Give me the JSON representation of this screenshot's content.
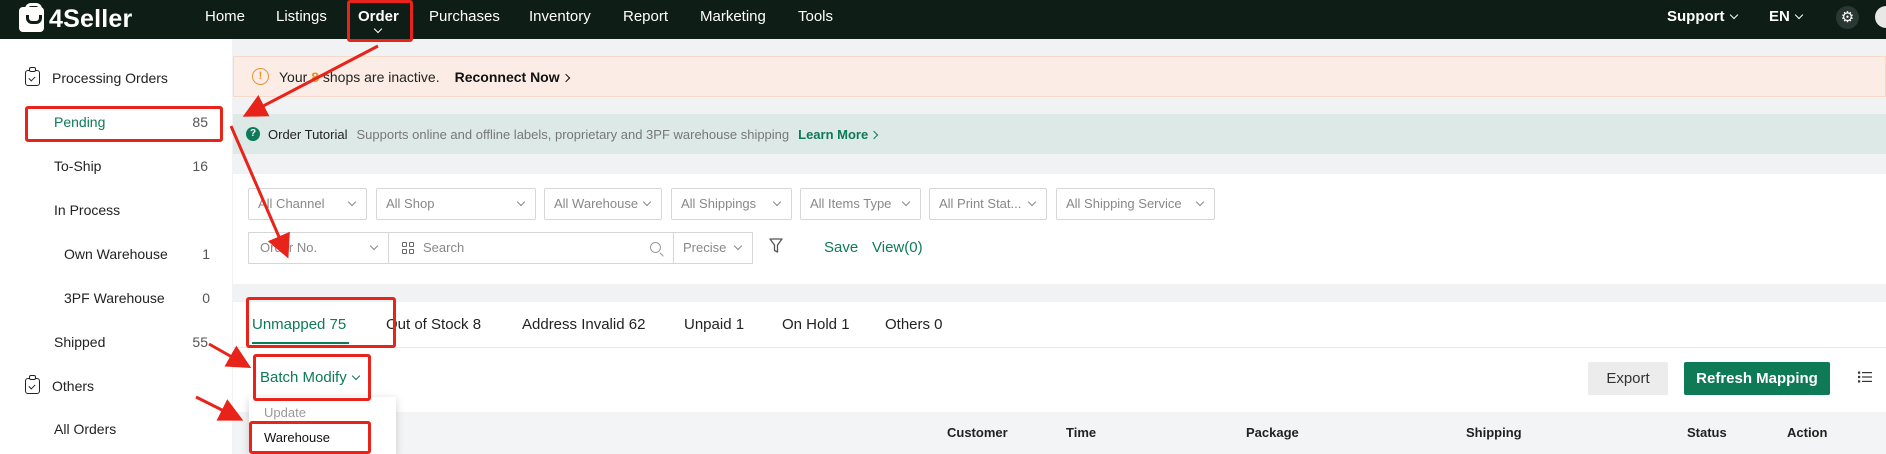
{
  "brand": {
    "name": "4Seller",
    "brand_color": "#0e7a56",
    "header_color": "#0f1d17",
    "annotation_color": "#e8231a"
  },
  "nav": {
    "items": [
      {
        "label": "Home"
      },
      {
        "label": "Listings"
      },
      {
        "label": "Order",
        "active": true
      },
      {
        "label": "Purchases"
      },
      {
        "label": "Inventory"
      },
      {
        "label": "Report"
      },
      {
        "label": "Marketing"
      },
      {
        "label": "Tools"
      }
    ],
    "support": "Support",
    "language": "EN",
    "settings_icon": "gear-icon"
  },
  "sidebar": {
    "processing_title": "Processing Orders",
    "items": [
      {
        "label": "Pending",
        "count": "85",
        "active": true
      },
      {
        "label": "To-Ship",
        "count": "16"
      },
      {
        "label": "In Process",
        "count": ""
      },
      {
        "label": "Own Warehouse",
        "count": "1"
      },
      {
        "label": "3PF Warehouse",
        "count": "0"
      },
      {
        "label": "Shipped",
        "count": "55"
      }
    ],
    "others_title": "Others",
    "others_items": [
      {
        "label": "All Orders"
      }
    ]
  },
  "alert": {
    "prefix": "Your ",
    "count": "8",
    "suffix": " shops are inactive.",
    "action": "Reconnect Now"
  },
  "tutorial": {
    "title": "Order Tutorial",
    "text": "Supports online and offline labels, proprietary and 3PF warehouse shipping",
    "link": "Learn More"
  },
  "filters": {
    "dropdowns": [
      "All Channel",
      "All Shop",
      "All Warehouse",
      "All Shippings",
      "All Items Type",
      "All Print Stat...",
      "All Shipping Service"
    ],
    "search_field": "Order No.",
    "search_placeholder": "Search",
    "match_mode": "Precise",
    "save": "Save",
    "view": "View(0)"
  },
  "tabs": [
    {
      "label": "Unmapped 75",
      "active": true
    },
    {
      "label": "Out of Stock 8"
    },
    {
      "label": "Address Invalid 62"
    },
    {
      "label": "Unpaid 1"
    },
    {
      "label": "On Hold 1"
    },
    {
      "label": "Others 0"
    }
  ],
  "toolbar": {
    "batch": "Batch Modify",
    "export": "Export",
    "refresh": "Refresh Mapping"
  },
  "batch_menu": {
    "header": "Update",
    "items": [
      "Warehouse"
    ]
  },
  "table": {
    "columns": [
      "Customer",
      "Time",
      "Package",
      "Shipping",
      "Status",
      "Action"
    ]
  }
}
